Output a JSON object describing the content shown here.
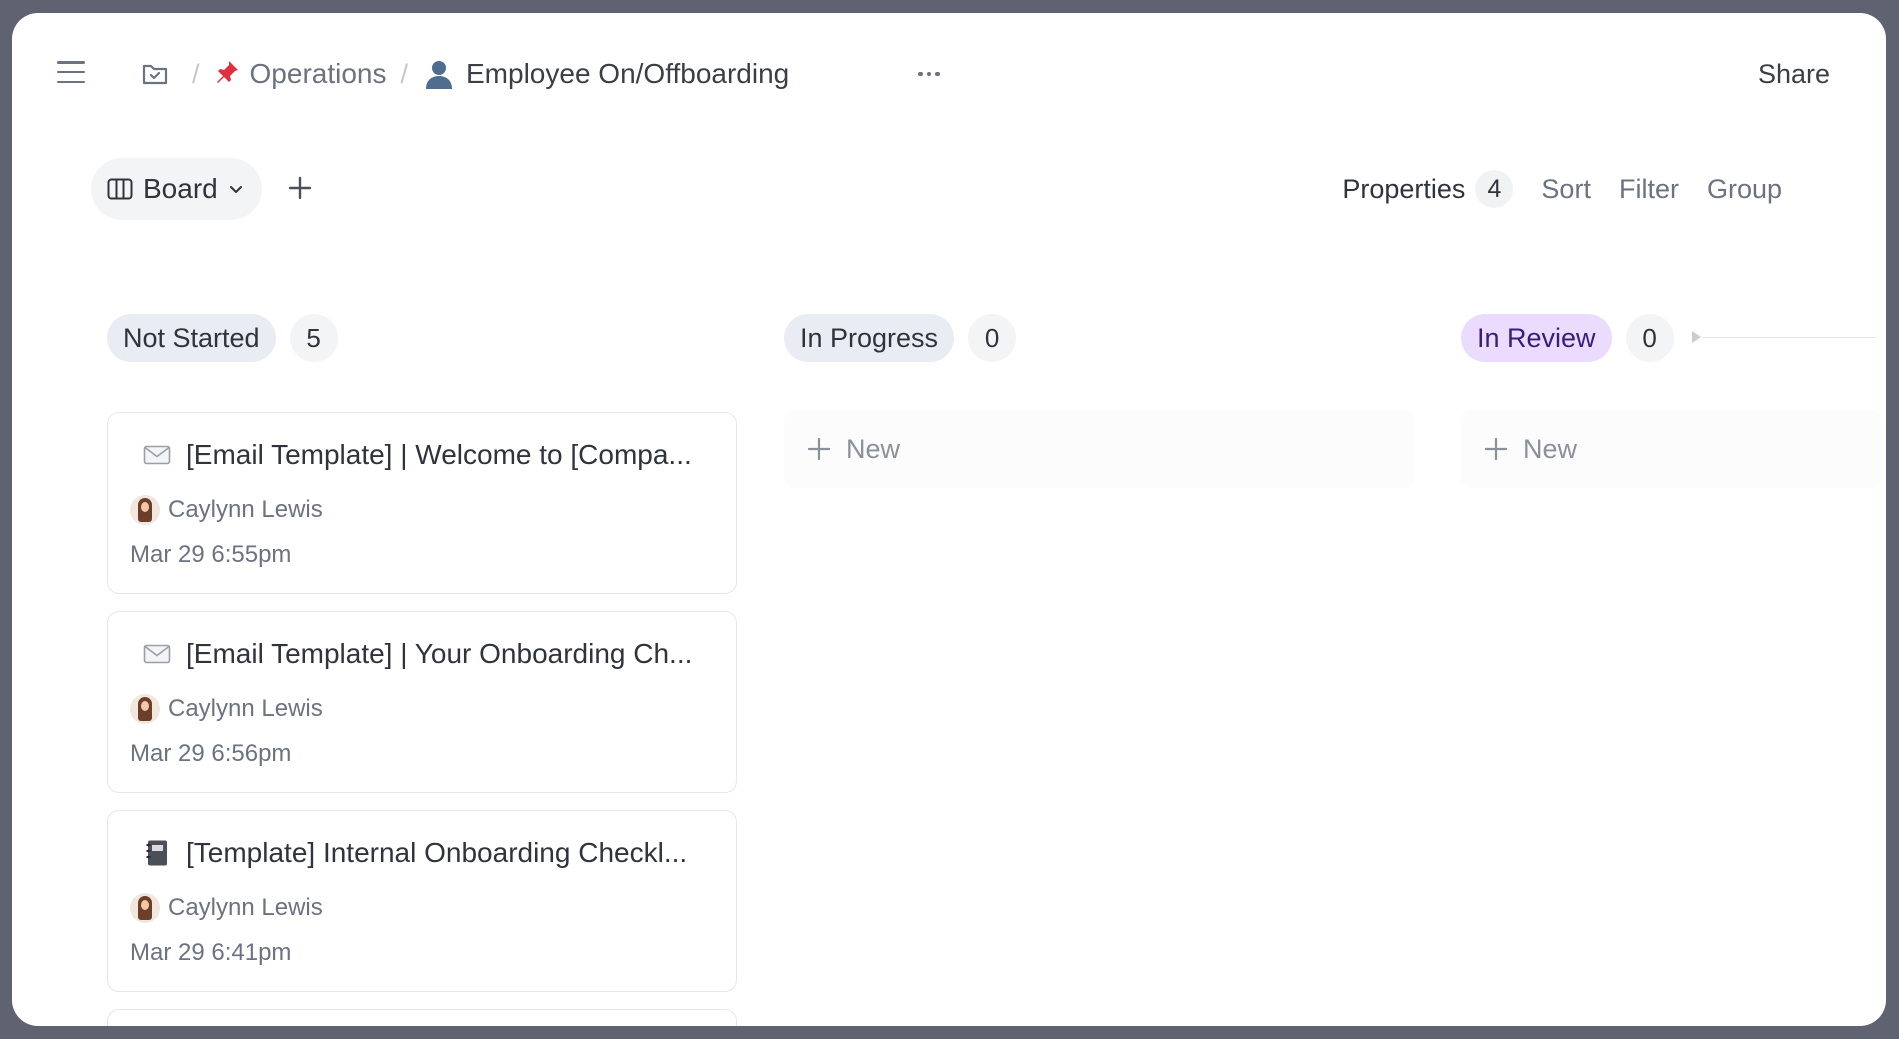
{
  "breadcrumb": {
    "parent_label": "Operations",
    "parent_icon": "pushpin-icon",
    "current_label": "Employee On/Offboarding",
    "current_icon": "person-icon",
    "separator": "/"
  },
  "header": {
    "share_label": "Share"
  },
  "view": {
    "current_view_label": "Board",
    "actions": {
      "properties_label": "Properties",
      "properties_count": "4",
      "sort_label": "Sort",
      "filter_label": "Filter",
      "group_label": "Group"
    }
  },
  "columns": [
    {
      "status": "Not Started",
      "count": "5",
      "color": "#e9ecf2"
    },
    {
      "status": "In Progress",
      "count": "0",
      "color": "#e9ecf2",
      "new_label": "New"
    },
    {
      "status": "In Review",
      "count": "0",
      "color": "#eadbff",
      "new_label": "New"
    }
  ],
  "cards": [
    {
      "icon": "envelope-icon",
      "title": "[Email Template] | Welcome to [Compa...",
      "owner": "Caylynn Lewis",
      "date": "Mar 29 6:55pm"
    },
    {
      "icon": "envelope-icon",
      "title": "[Email Template] | Your Onboarding Ch...",
      "owner": "Caylynn Lewis",
      "date": "Mar 29 6:56pm"
    },
    {
      "icon": "notebook-icon",
      "title": "[Template] Internal Onboarding Checkl...",
      "owner": "Caylynn Lewis",
      "date": "Mar 29 6:41pm"
    }
  ]
}
